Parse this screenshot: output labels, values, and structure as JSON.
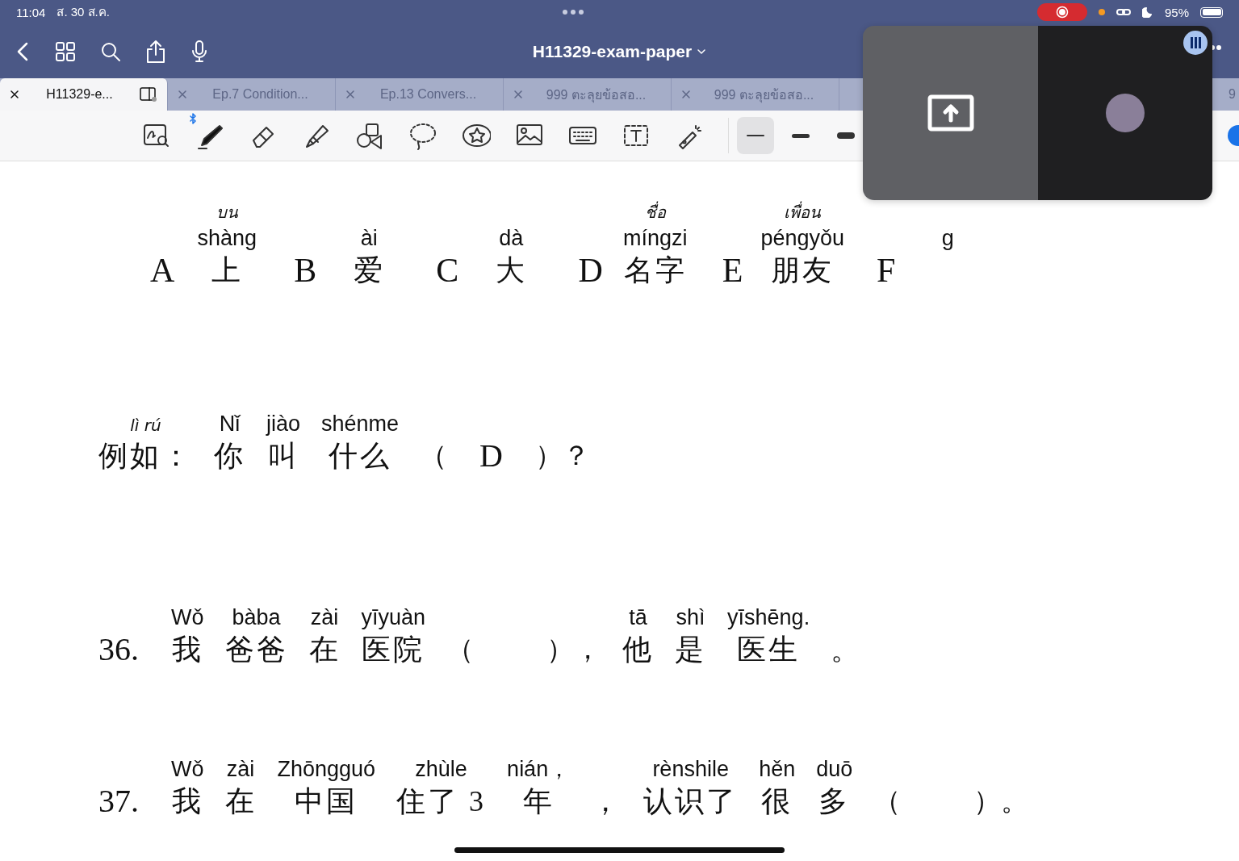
{
  "status_bar": {
    "time": "11:04",
    "date": "ส. 30 ส.ค.",
    "battery": "95%",
    "recording": true
  },
  "nav_bar": {
    "title": "H11329-exam-paper"
  },
  "tabs": [
    {
      "label": "H11329-e...",
      "selected": true
    },
    {
      "label": "Ep.7 Condition...",
      "selected": false
    },
    {
      "label": "Ep.13 Convers...",
      "selected": false
    },
    {
      "label": "999 ตะลุยข้อสอ...",
      "selected": false
    },
    {
      "label": "999 ตะลุยข้อสอ...",
      "selected": false
    },
    {
      "label": "9",
      "selected": false
    }
  ],
  "toolbar": {
    "tools": [
      {
        "kind": "zoom"
      },
      {
        "kind": "pen"
      },
      {
        "kind": "eraser"
      },
      {
        "kind": "highlighter"
      },
      {
        "kind": "shapes"
      },
      {
        "kind": "lasso"
      },
      {
        "kind": "sticker"
      },
      {
        "kind": "image"
      },
      {
        "kind": "keyboard"
      },
      {
        "kind": "text"
      },
      {
        "kind": "laser"
      }
    ],
    "widths": [
      {
        "selected": true
      },
      {
        "selected": false
      },
      {
        "selected": false
      }
    ],
    "color": "#1a73e8"
  },
  "page": {
    "options": [
      {
        "letter": "A",
        "note": "บน",
        "pinyin": "shàng",
        "hanzi": "上"
      },
      {
        "letter": "B",
        "pinyin": "ài",
        "hanzi": "爱"
      },
      {
        "letter": "C",
        "pinyin": "dà",
        "hanzi": "大"
      },
      {
        "letter": "D",
        "note": "ชื่อ",
        "pinyin": "míngzi",
        "hanzi": "名字"
      },
      {
        "letter": "E",
        "note": "เพื่อน",
        "pinyin": "péngyǒu",
        "hanzi": "朋友"
      },
      {
        "letter": "F",
        "pinyin": "g"
      }
    ],
    "example": {
      "note": "lì rú",
      "label": "例如：",
      "tokens": [
        {
          "kind": "word",
          "pinyin": "Nǐ",
          "hanzi": "你"
        },
        {
          "kind": "word",
          "pinyin": "jiào",
          "hanzi": "叫"
        },
        {
          "kind": "word",
          "pinyin": "shénme",
          "hanzi": "什么"
        },
        {
          "kind": "blank",
          "open": "（",
          "answer": "D",
          "close": "）？"
        }
      ]
    },
    "questions": [
      {
        "number": "36.",
        "tokens": [
          {
            "kind": "word",
            "pinyin": "Wǒ",
            "hanzi": "我"
          },
          {
            "kind": "word",
            "pinyin": "bàba",
            "hanzi": "爸爸"
          },
          {
            "kind": "word",
            "pinyin": "zài",
            "hanzi": "在"
          },
          {
            "kind": "word",
            "pinyin": "yīyuàn",
            "hanzi": "医院"
          },
          {
            "kind": "blank",
            "open": "（",
            "close": "），"
          },
          {
            "kind": "word",
            "pinyin": "tā",
            "hanzi": "他"
          },
          {
            "kind": "word",
            "pinyin": "shì",
            "hanzi": "是"
          },
          {
            "kind": "word",
            "pinyin": "yīshēng.",
            "hanzi": "医生"
          },
          {
            "kind": "word",
            "hanzi": "。"
          }
        ]
      },
      {
        "number": "37.",
        "tokens": [
          {
            "kind": "word",
            "pinyin": "Wǒ",
            "hanzi": "我"
          },
          {
            "kind": "word",
            "pinyin": "zài",
            "hanzi": "在"
          },
          {
            "kind": "word",
            "pinyin": "Zhōngguó",
            "hanzi": "中国"
          },
          {
            "kind": "word",
            "pinyin": "zhùle",
            "hanzi": "住了 3"
          },
          {
            "kind": "word",
            "pinyin": "nián，",
            "hanzi": "年"
          },
          {
            "kind": "word",
            "hanzi": "，"
          },
          {
            "kind": "word",
            "pinyin": "rènshile",
            "hanzi": "认识了"
          },
          {
            "kind": "word",
            "pinyin": "hěn",
            "hanzi": "很"
          },
          {
            "kind": "word",
            "pinyin": "duō",
            "hanzi": "多"
          },
          {
            "kind": "blank",
            "open": "（",
            "close": "）。"
          }
        ]
      }
    ]
  }
}
